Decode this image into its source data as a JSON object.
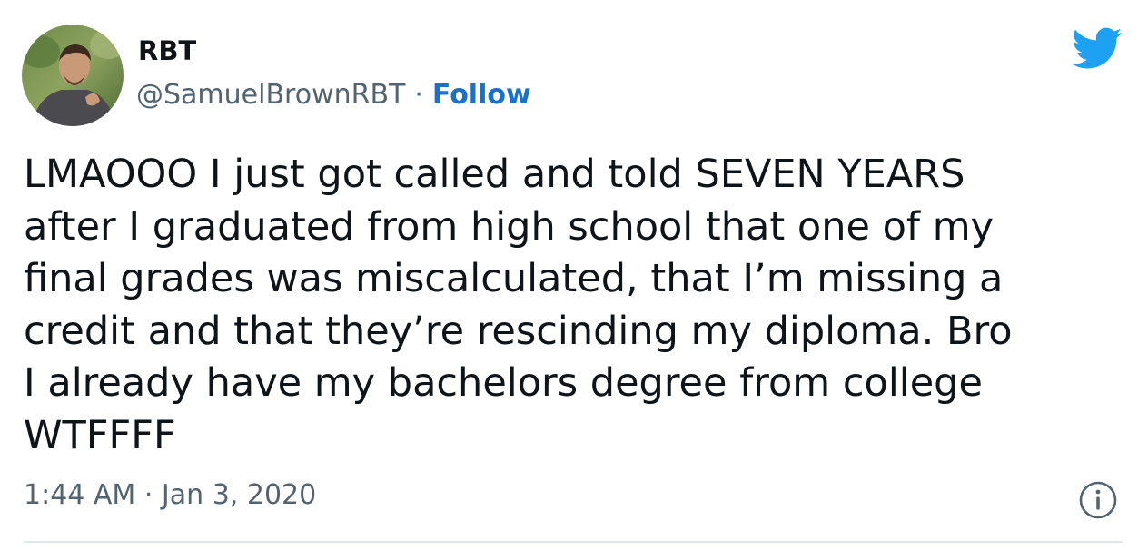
{
  "tweet": {
    "author": {
      "display_name": "RBT",
      "handle": "@SamuelBrownRBT",
      "separator": "·",
      "follow_label": "Follow",
      "avatar_icon": "user-avatar-photo"
    },
    "platform_icon": "twitter-bird-icon",
    "text": "LMAOOO I just got called and told SEVEN YEARS\nafter I graduated from high school that one of my\nfinal grades was miscalculated, that I’m missing a\ncredit and that they’re rescinding my diploma. Bro\nI already have my bachelors degree from college\nWTFFFF",
    "timestamp": "1:44 AM · Jan 3, 2020",
    "info_icon": "info-icon"
  },
  "colors": {
    "text_primary": "#0f1419",
    "text_secondary": "#536471",
    "follow_link": "#1d70c7",
    "twitter_blue": "#1da1f2",
    "divider": "#e1e8ed"
  }
}
